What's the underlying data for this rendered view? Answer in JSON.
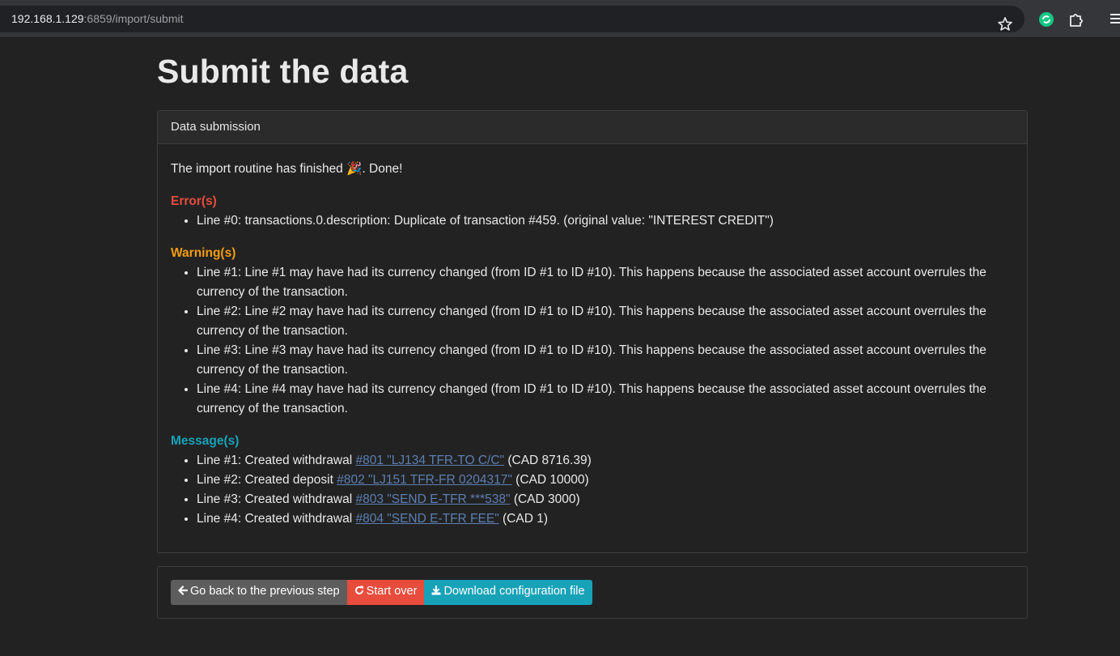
{
  "browser": {
    "url_host": "192.168.1.129",
    "url_rest": ":6859/import/submit",
    "icons": [
      "star-icon",
      "extension-green-icon",
      "puzzle-icon",
      "menu-icon"
    ]
  },
  "page": {
    "title": "Submit the data"
  },
  "submission": {
    "header": "Data submission",
    "intro": "The import routine has finished 🎉. Done!",
    "errors_title": "Error(s)",
    "errors": [
      "Line #0: transactions.0.description: Duplicate of transaction #459. (original value: \"INTEREST CREDIT\")"
    ],
    "warnings_title": "Warning(s)",
    "warnings": [
      "Line #1: Line #1 may have had its currency changed (from ID #1 to ID #10). This happens because the associated asset account overrules the currency of the transaction.",
      "Line #2: Line #2 may have had its currency changed (from ID #1 to ID #10). This happens because the associated asset account overrules the currency of the transaction.",
      "Line #3: Line #3 may have had its currency changed (from ID #1 to ID #10). This happens because the associated asset account overrules the currency of the transaction.",
      "Line #4: Line #4 may have had its currency changed (from ID #1 to ID #10). This happens because the associated asset account overrules the currency of the transaction."
    ],
    "messages_title": "Message(s)",
    "messages": [
      {
        "prefix": "Line #1: Created withdrawal ",
        "link": "#801 \"LJ134 TFR-TO C/C\"",
        "suffix": " (CAD 8716.39)"
      },
      {
        "prefix": "Line #2: Created deposit ",
        "link": "#802 \"LJ151 TFR-FR 0204317\"",
        "suffix": " (CAD 10000)"
      },
      {
        "prefix": "Line #3: Created withdrawal ",
        "link": "#803 \"SEND E-TFR ***538\"",
        "suffix": " (CAD 3000)"
      },
      {
        "prefix": "Line #4: Created withdrawal ",
        "link": "#804 \"SEND E-TFR FEE\"",
        "suffix": " (CAD 1)"
      }
    ]
  },
  "actions": {
    "back_label": "Go back to the previous step",
    "start_over_label": "Start over",
    "download_label": "Download configuration file"
  },
  "colors": {
    "error": "#e74c3c",
    "warning": "#f39c12",
    "message": "#17a2b8",
    "link": "#5b7fb3",
    "back_button": "#5d5d5d",
    "start_over_button": "#e74c3c",
    "download_button": "#17a2b8"
  }
}
